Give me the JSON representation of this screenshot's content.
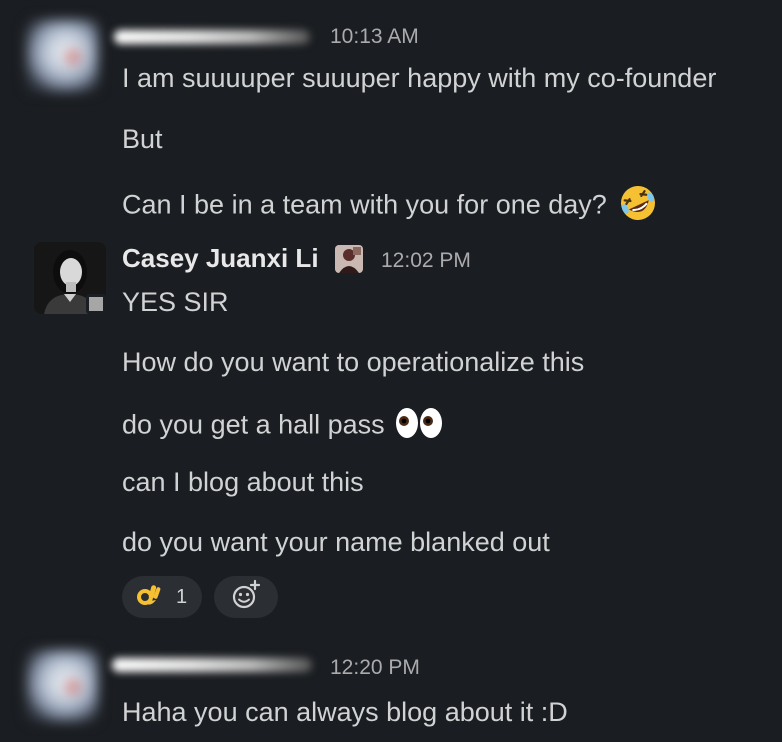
{
  "messages": [
    {
      "timestamp": "10:13 AM",
      "lines": [
        "I am suuuuper suuuper happy with my co-founder",
        "But",
        "Can I be in a team with you for one day?"
      ],
      "emoji": "rolling-on-floor-laughing"
    },
    {
      "author": "Casey Juanxi Li",
      "timestamp": "12:02 PM",
      "lines": [
        "YES SIR",
        "How do you want to operationalize this",
        "do you get a hall pass",
        "can I blog about this",
        "do you want your name blanked out"
      ],
      "emoji": "eyes",
      "reactions": [
        {
          "emoji": "ok-hand",
          "count": "1"
        }
      ]
    },
    {
      "timestamp": "12:20 PM",
      "lines": [
        "Haha you can always blog about it :D"
      ]
    }
  ],
  "colors": {
    "background": "#1a1d21",
    "text": "#d1d2d3",
    "timestamp": "#ababad",
    "reaction_bg": "#2b2e33"
  }
}
